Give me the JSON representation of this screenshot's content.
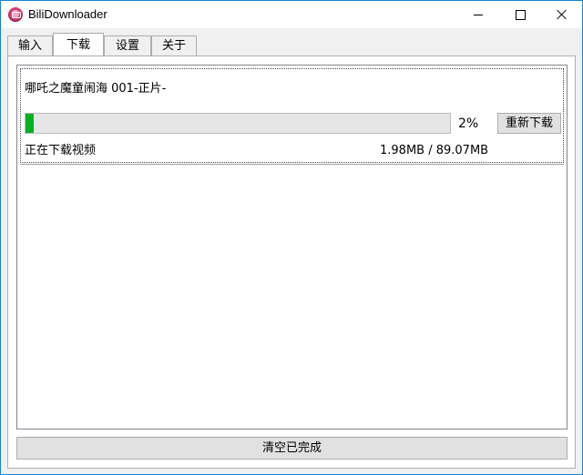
{
  "window": {
    "title": "BiliDownloader"
  },
  "tabs": [
    {
      "label": "输入",
      "active": false
    },
    {
      "label": "下载",
      "active": true
    },
    {
      "label": "设置",
      "active": false
    },
    {
      "label": "关于",
      "active": false
    }
  ],
  "download": {
    "items": [
      {
        "title": "哪吒之魔童闹海 001-正片-",
        "progress_percent": 2,
        "percent_label": "2%",
        "status": "正在下载视频",
        "size": "1.98MB / 89.07MB",
        "redownload_label": "重新下载"
      }
    ],
    "clear_completed_label": "清空已完成"
  },
  "colors": {
    "accent_border": "#1883d7",
    "progress_fill": "#06b025"
  }
}
